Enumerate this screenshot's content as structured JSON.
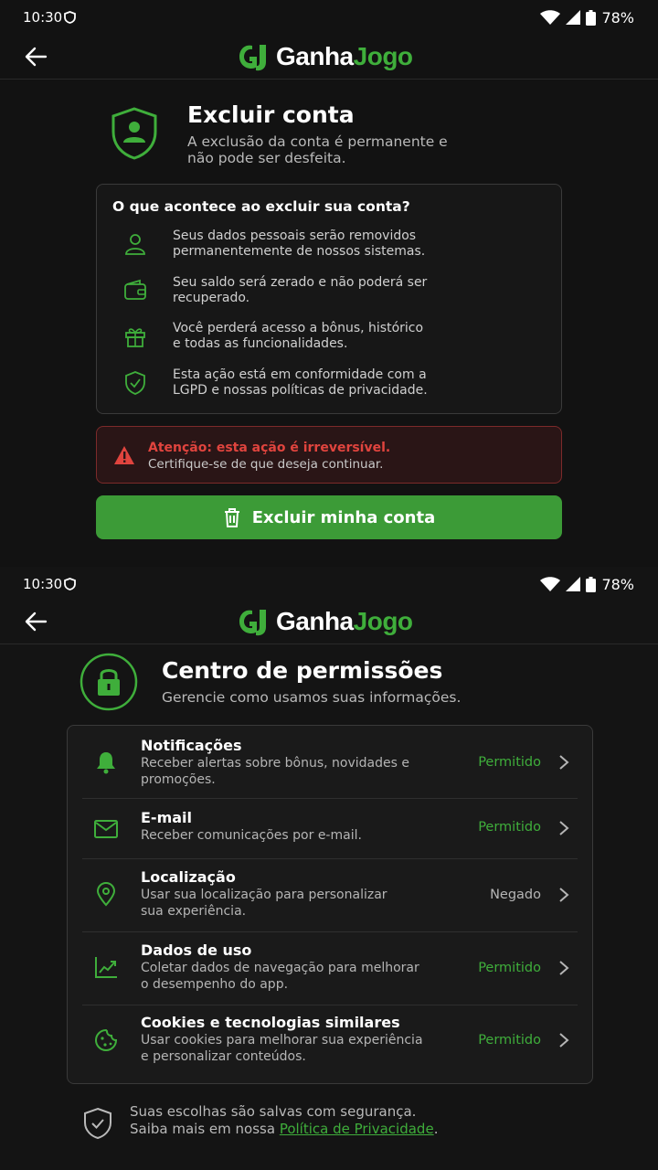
{
  "status_bar": {
    "time": "10:30",
    "battery": "78%"
  },
  "brand": {
    "part1": "Ganha",
    "part2": "Jogo",
    "accent": "#3fae3b"
  },
  "delete_screen": {
    "title": "Excluir conta",
    "subtitle_line1": "A exclusão da conta é permanente e",
    "subtitle_line2": "não pode ser desfeita.",
    "card_title": "O que acontece ao excluir sua conta?",
    "items": [
      {
        "icon": "user-icon",
        "line1": "Seus dados pessoais serão removidos",
        "line2": "permanentemente de nossos sistemas."
      },
      {
        "icon": "wallet-icon",
        "line1": "Seu saldo será zerado e não poderá ser",
        "line2": "recuperado."
      },
      {
        "icon": "gift-icon",
        "line1": "Você perderá acesso a bônus, histórico",
        "line2": "e todas as funcionalidades."
      },
      {
        "icon": "shield-check-icon",
        "line1": "Esta ação está em conformidade com a",
        "line2": "LGPD e nossas políticas de privacidade."
      }
    ],
    "alert_title": "Atenção: esta ação é irreversível.",
    "alert_text": "Certifique-se de que deseja continuar.",
    "button_label": "Excluir minha conta"
  },
  "permissions_screen": {
    "title": "Centro de permissões",
    "subtitle": "Gerencie como usamos suas informações.",
    "items": [
      {
        "icon": "bell-icon",
        "title": "Notificações",
        "line1": "Receber alertas sobre bônus, novidades e",
        "line2": "promoções.",
        "status": "Permitido",
        "allowed": true
      },
      {
        "icon": "mail-icon",
        "title": "E-mail",
        "line1": "Receber comunicações por e-mail.",
        "line2": "",
        "status": "Permitido",
        "allowed": true
      },
      {
        "icon": "location-pin-icon",
        "title": "Localização",
        "line1": "Usar sua localização para personalizar",
        "line2": "sua experiência.",
        "status": "Negado",
        "allowed": false
      },
      {
        "icon": "chart-trend-icon",
        "title": "Dados de uso",
        "line1": "Coletar dados de navegação para melhorar",
        "line2": "o desempenho do app.",
        "status": "Permitido",
        "allowed": true
      },
      {
        "icon": "cookie-icon",
        "title": "Cookies e tecnologias similares",
        "line1": "Usar cookies para melhorar sua experiência",
        "line2": "e personalizar conteúdos.",
        "status": "Permitido",
        "allowed": true
      }
    ],
    "footer_line1": "Suas escolhas são salvas com segurança.",
    "footer_line2_prefix": "Saiba mais em nossa ",
    "footer_link": "Política de Privacidade",
    "footer_line2_suffix": "."
  }
}
